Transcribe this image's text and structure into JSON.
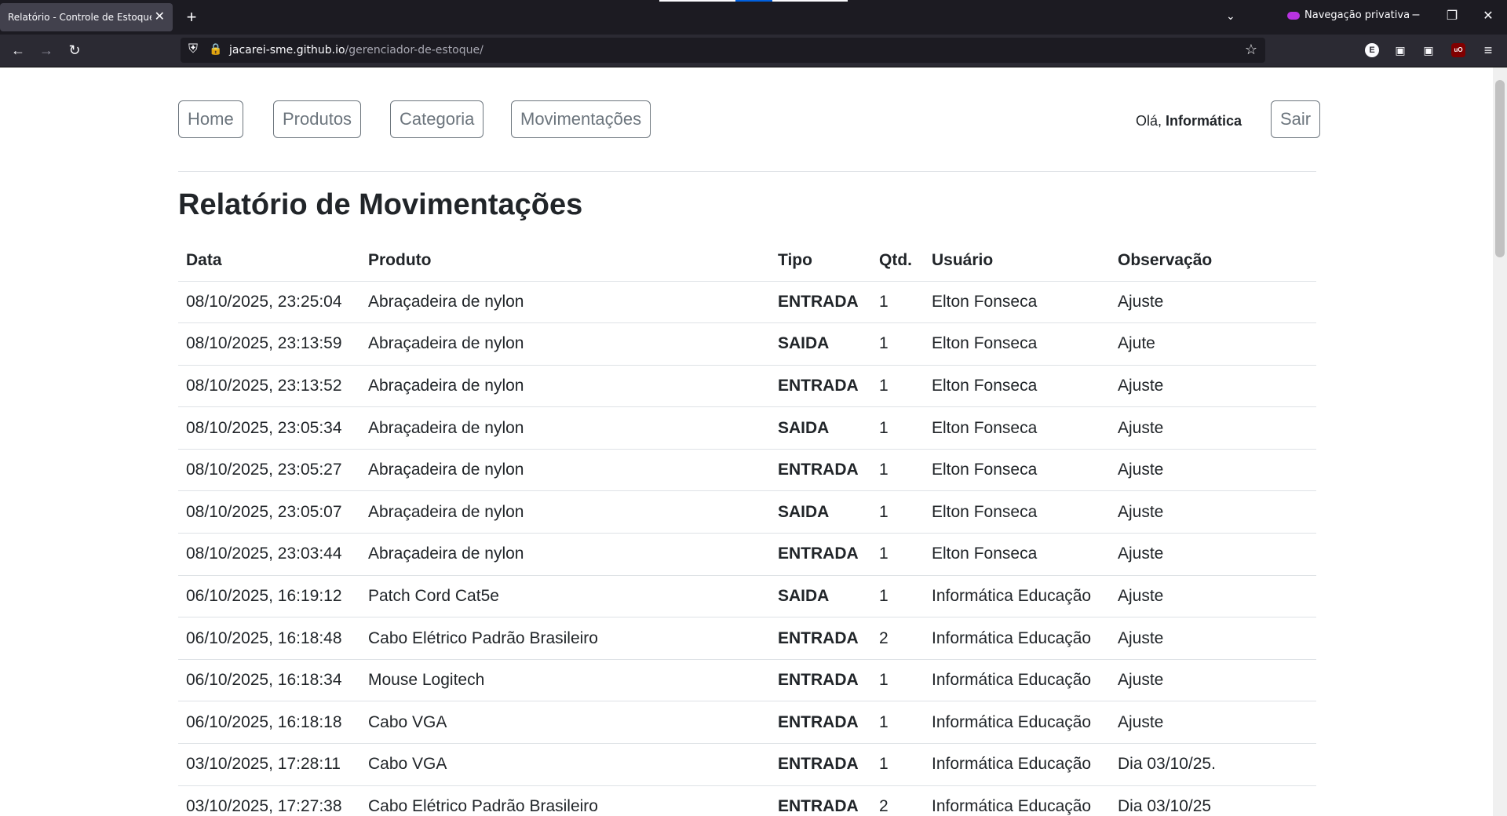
{
  "browser": {
    "tab_title": "Relatório - Controle de Estoque DTI",
    "tab_close": "✕",
    "new_tab": "+",
    "private_label": "Navegação privativa",
    "url_host": "jacarei-sme.github.io",
    "url_path": "/gerenciador-de-estoque/"
  },
  "nav": {
    "home": "Home",
    "produtos": "Produtos",
    "categoria": "Categoria",
    "movimentacoes": "Movimentações",
    "greeting_prefix": "Olá, ",
    "user_name": "Informática",
    "logout": "Sair"
  },
  "page": {
    "title": "Relatório de Movimentações"
  },
  "table": {
    "headers": [
      "Data",
      "Produto",
      "Tipo",
      "Qtd.",
      "Usuário",
      "Observação"
    ],
    "rows": [
      [
        "08/10/2025, 23:25:04",
        "Abraçadeira de nylon",
        "ENTRADA",
        "1",
        "Elton Fonseca",
        "Ajuste"
      ],
      [
        "08/10/2025, 23:13:59",
        "Abraçadeira de nylon",
        "SAIDA",
        "1",
        "Elton Fonseca",
        "Ajute"
      ],
      [
        "08/10/2025, 23:13:52",
        "Abraçadeira de nylon",
        "ENTRADA",
        "1",
        "Elton Fonseca",
        "Ajuste"
      ],
      [
        "08/10/2025, 23:05:34",
        "Abraçadeira de nylon",
        "SAIDA",
        "1",
        "Elton Fonseca",
        "Ajuste"
      ],
      [
        "08/10/2025, 23:05:27",
        "Abraçadeira de nylon",
        "ENTRADA",
        "1",
        "Elton Fonseca",
        "Ajuste"
      ],
      [
        "08/10/2025, 23:05:07",
        "Abraçadeira de nylon",
        "SAIDA",
        "1",
        "Elton Fonseca",
        "Ajuste"
      ],
      [
        "08/10/2025, 23:03:44",
        "Abraçadeira de nylon",
        "ENTRADA",
        "1",
        "Elton Fonseca",
        "Ajuste"
      ],
      [
        "06/10/2025, 16:19:12",
        "Patch Cord Cat5e",
        "SAIDA",
        "1",
        "Informática Educação",
        "Ajuste"
      ],
      [
        "06/10/2025, 16:18:48",
        "Cabo Elétrico Padrão Brasileiro",
        "ENTRADA",
        "2",
        "Informática Educação",
        "Ajuste"
      ],
      [
        "06/10/2025, 16:18:34",
        "Mouse Logitech",
        "ENTRADA",
        "1",
        "Informática Educação",
        "Ajuste"
      ],
      [
        "06/10/2025, 16:18:18",
        "Cabo VGA",
        "ENTRADA",
        "1",
        "Informática Educação",
        "Ajuste"
      ],
      [
        "03/10/2025, 17:28:11",
        "Cabo VGA",
        "ENTRADA",
        "1",
        "Informática Educação",
        "Dia 03/10/25."
      ],
      [
        "03/10/2025, 17:27:38",
        "Cabo Elétrico Padrão Brasileiro",
        "ENTRADA",
        "2",
        "Informática Educação",
        "Dia 03/10/25"
      ]
    ]
  }
}
